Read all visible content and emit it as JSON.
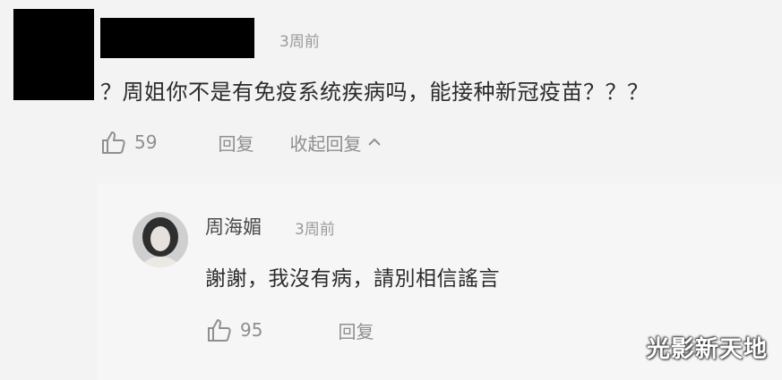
{
  "comment": {
    "time": "3周前",
    "text": "？周姐你不是有免疫系统疾病吗，能接种新冠疫苗？？？",
    "like_count": "59",
    "reply_label": "回复",
    "collapse_label": "收起回复"
  },
  "reply": {
    "author": "周海媚",
    "time": "3周前",
    "text": "謝謝，我沒有病，請別相信謠言",
    "like_count": "95",
    "reply_label": "回复"
  },
  "watermark": "光影新天地",
  "icons": {
    "like": "thumbs-up-icon",
    "collapse": "chevron-up-icon"
  }
}
